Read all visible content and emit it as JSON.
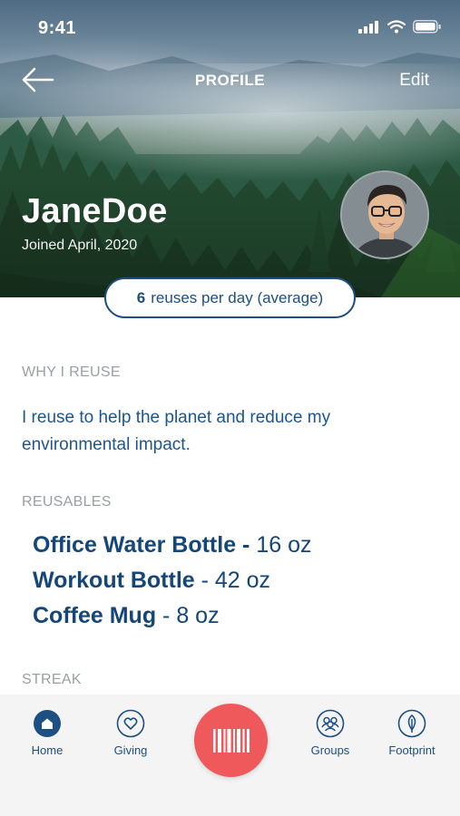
{
  "status_bar": {
    "time": "9:41",
    "icons": [
      "signal-icon",
      "wifi-icon",
      "battery-icon"
    ]
  },
  "nav": {
    "back_icon": "arrow-left-icon",
    "title": "PROFILE",
    "edit_label": "Edit"
  },
  "profile": {
    "name": "JaneDoe",
    "joined": "Joined April, 2020",
    "stat": {
      "value": "6",
      "label": "reuses per day (average)"
    }
  },
  "why": {
    "heading": "WHY I REUSE",
    "text": "I reuse to help the planet and reduce my environmental impact."
  },
  "reusables": {
    "heading": "REUSABLES",
    "items": [
      {
        "name": "Office Water Bottle -",
        "size": " 16 oz"
      },
      {
        "name": "Workout Bottle",
        "size": " - 42 oz"
      },
      {
        "name": "Coffee Mug",
        "size": " - 8 oz"
      }
    ]
  },
  "streak": {
    "heading": "STREAK"
  },
  "tabs": [
    {
      "label": "Home",
      "icon": "home-icon",
      "active": true
    },
    {
      "label": "Giving",
      "icon": "heart-icon",
      "active": false
    },
    {
      "label": "Groups",
      "icon": "groups-icon",
      "active": false
    },
    {
      "label": "Footprint",
      "icon": "leaf-icon",
      "active": false
    }
  ],
  "scan_button": {
    "icon": "barcode-icon"
  },
  "colors": {
    "primary": "#1d4f82",
    "accent": "#f0595c",
    "label": "#9a9fa3"
  }
}
